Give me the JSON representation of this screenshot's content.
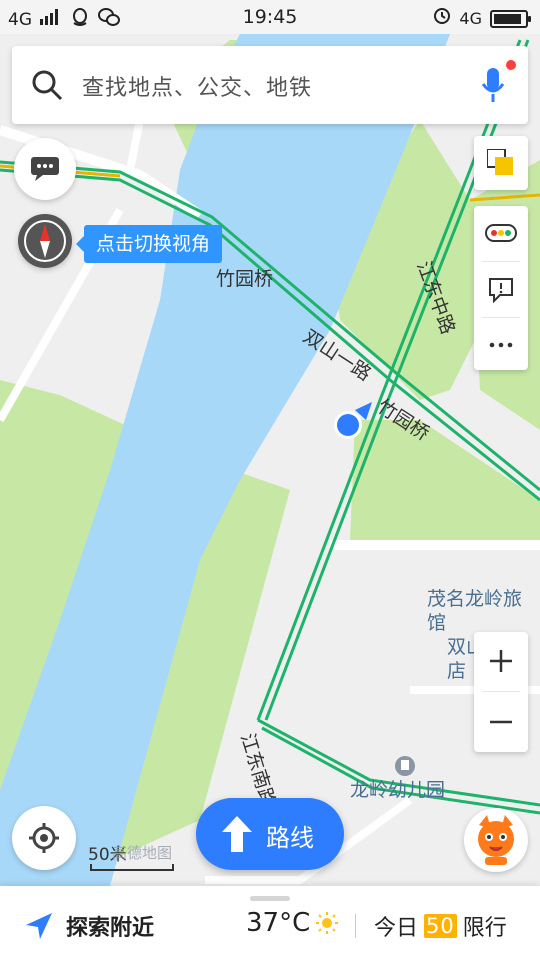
{
  "status_bar": {
    "network": "4G",
    "time": "19:45",
    "right_network": "4G",
    "battery_level": 0.9
  },
  "search": {
    "placeholder": "查找地点、公交、地铁"
  },
  "map": {
    "tooltip": "点击切换视角",
    "labels": {
      "bridge": "竹园桥",
      "road1": "双山一路",
      "bridge2": "竹园桥",
      "east_road_north": "江东中路",
      "east_road_south": "江东南路"
    },
    "pois": {
      "hotel_line1": "茂名龙岭旅馆",
      "hotel_line2": "双山一路店",
      "kindergarten": "龙岭幼儿园"
    },
    "scale": "50米",
    "watermark": "高德地图"
  },
  "buttons": {
    "route": "路线"
  },
  "bottom_bar": {
    "nearby": "探索附近",
    "temperature": "37°C",
    "today": "今日",
    "limit_number": "50",
    "limit_label": "限行"
  },
  "colors": {
    "accent_blue": "#2f7dff",
    "water": "#a8d8f8",
    "green_area": "#c7e8a5",
    "road_green": "#1db36a",
    "limit_badge": "#ffb300"
  }
}
